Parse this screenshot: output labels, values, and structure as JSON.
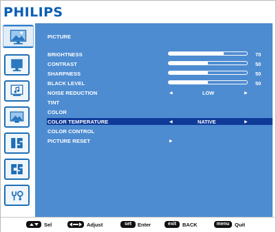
{
  "brand": "PHILIPS",
  "sidebar": {
    "icons": [
      {
        "name": "picture-icon",
        "active": true
      },
      {
        "name": "screen-icon",
        "active": false
      },
      {
        "name": "audio-icon",
        "active": false
      },
      {
        "name": "pip-icon",
        "active": false
      },
      {
        "name": "config1-icon",
        "active": false
      },
      {
        "name": "config2-icon",
        "active": false
      },
      {
        "name": "advanced-option-icon",
        "active": false
      }
    ]
  },
  "menu": {
    "title": "PICTURE",
    "brightness": {
      "label": "BRIGHTNESS",
      "value": "70",
      "level": 0.7
    },
    "contrast": {
      "label": "CONTRAST",
      "value": "50",
      "level": 0.5
    },
    "sharpness": {
      "label": "SHARPNESS",
      "value": "50",
      "level": 0.5
    },
    "black_level": {
      "label": "BLACK LEVEL",
      "value": "50",
      "level": 0.5
    },
    "noise_reduction": {
      "label": "NOISE REDUCTION",
      "value": "LOW"
    },
    "tint": {
      "label": "TINT"
    },
    "color": {
      "label": "COLOR"
    },
    "color_temperature": {
      "label": "COLOR TEMPERATURE",
      "value": "NATIVE",
      "selected": true
    },
    "color_control": {
      "label": "COLOR CONTROL"
    },
    "picture_reset": {
      "label": "PICTURE RESET"
    }
  },
  "footer": {
    "sel_label": "Sel",
    "adjust_label": "Adjust",
    "set_key": "set",
    "enter_label": "Enter",
    "exit_key": "exit",
    "back_label": "BACK",
    "menu_key": "menu",
    "quit_label": "Quit"
  },
  "colors": {
    "brand": "#0b5fb4",
    "panel": "#4e8cd1",
    "highlight": "#0f3a98",
    "text": "#ffffff"
  }
}
